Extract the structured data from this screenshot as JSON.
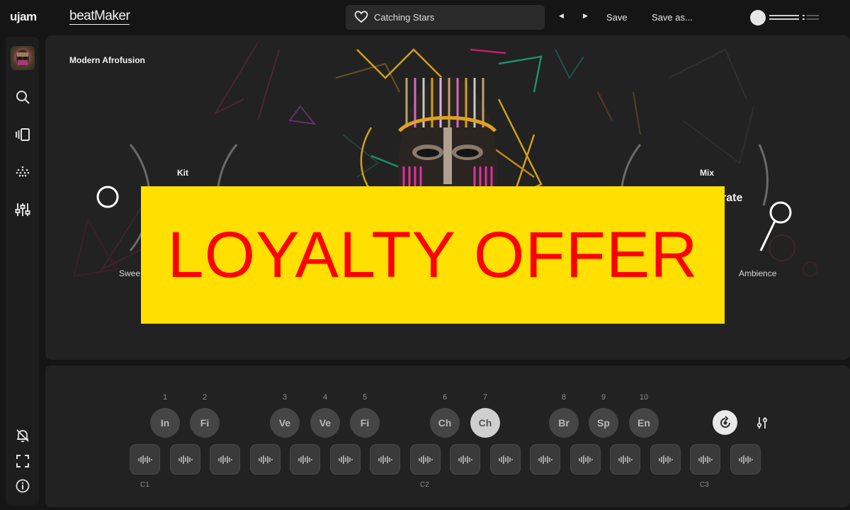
{
  "app": {
    "vendor": "ujam",
    "product": "beatMaker"
  },
  "preset": {
    "name": "Catching Stars",
    "favorite_icon": "heart-icon"
  },
  "toolbar": {
    "prev_icon": "caret-left-icon",
    "next_icon": "caret-right-icon",
    "save_label": "Save",
    "save_as_label": "Save as..."
  },
  "sidebar": {
    "items": [
      "kit-avatar",
      "search-icon",
      "library-icon",
      "pattern-icon",
      "mixer-icon",
      "notification-off-icon",
      "fullscreen-icon",
      "info-icon"
    ]
  },
  "main": {
    "style_title": "Modern Afrofusion",
    "kit_label": "Kit",
    "mix_label": "Mix",
    "left_knob_caption_partial": "Swee",
    "right_partial_label": "rate",
    "right_knob_caption": "Ambience"
  },
  "banner": {
    "text": "LOYALTY OFFER",
    "bg": "#ffe000",
    "fg": "#ff0000"
  },
  "patterns": [
    {
      "number": "1",
      "label": "In",
      "active": false
    },
    {
      "number": "2",
      "label": "Fi",
      "active": false
    },
    {
      "number": "3",
      "label": "Ve",
      "active": false
    },
    {
      "number": "4",
      "label": "Ve",
      "active": false
    },
    {
      "number": "5",
      "label": "Fi",
      "active": false
    },
    {
      "number": "6",
      "label": "Ch",
      "active": false
    },
    {
      "number": "7",
      "label": "Ch",
      "active": true
    },
    {
      "number": "8",
      "label": "Br",
      "active": false
    },
    {
      "number": "9",
      "label": "Sp",
      "active": false
    },
    {
      "number": "10",
      "label": "En",
      "active": false
    }
  ],
  "octaves": [
    "C1",
    "C2",
    "C3"
  ],
  "trigger_count": 16,
  "colors": {
    "background": "#151515",
    "panel": "#222222",
    "pad": "#454545",
    "pad_active": "#cfcfcf"
  }
}
